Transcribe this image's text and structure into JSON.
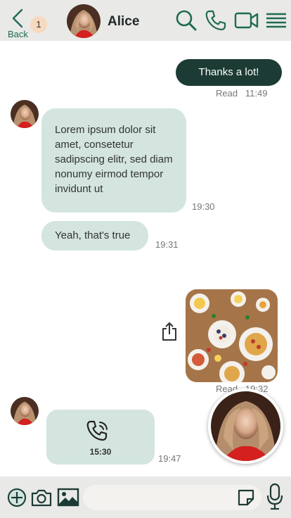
{
  "header": {
    "back_label": "Back",
    "unread_count": "1",
    "contact_name": "Alice",
    "icons": [
      "search-icon",
      "phone-icon",
      "video-camera-icon",
      "menu-icon"
    ]
  },
  "messages": [
    {
      "direction": "out",
      "text": "Thanks a lot!",
      "status": "Read",
      "time": "11:49"
    },
    {
      "direction": "in",
      "text": "Lorem ipsum dolor sit amet, consetetur sadipscing elitr, sed diam nonumy eirmod tempor invidunt ut",
      "time": "19:30"
    },
    {
      "direction": "in",
      "text": "Yeah, that's true",
      "time": "19:31"
    },
    {
      "direction": "out",
      "type": "image",
      "status": "Read",
      "time": "19:32"
    },
    {
      "direction": "in",
      "type": "call",
      "duration": "15:30",
      "time": "19:47"
    }
  ],
  "composer": {
    "value": "",
    "placeholder": "",
    "icons": [
      "plus-icon",
      "camera-icon",
      "image-icon",
      "sticker-icon",
      "microphone-icon"
    ]
  },
  "colors": {
    "accent": "#1f6b52",
    "bubble_in": "#d3e5de",
    "bubble_out": "#1c3b34",
    "bar": "#e9e9e7"
  }
}
